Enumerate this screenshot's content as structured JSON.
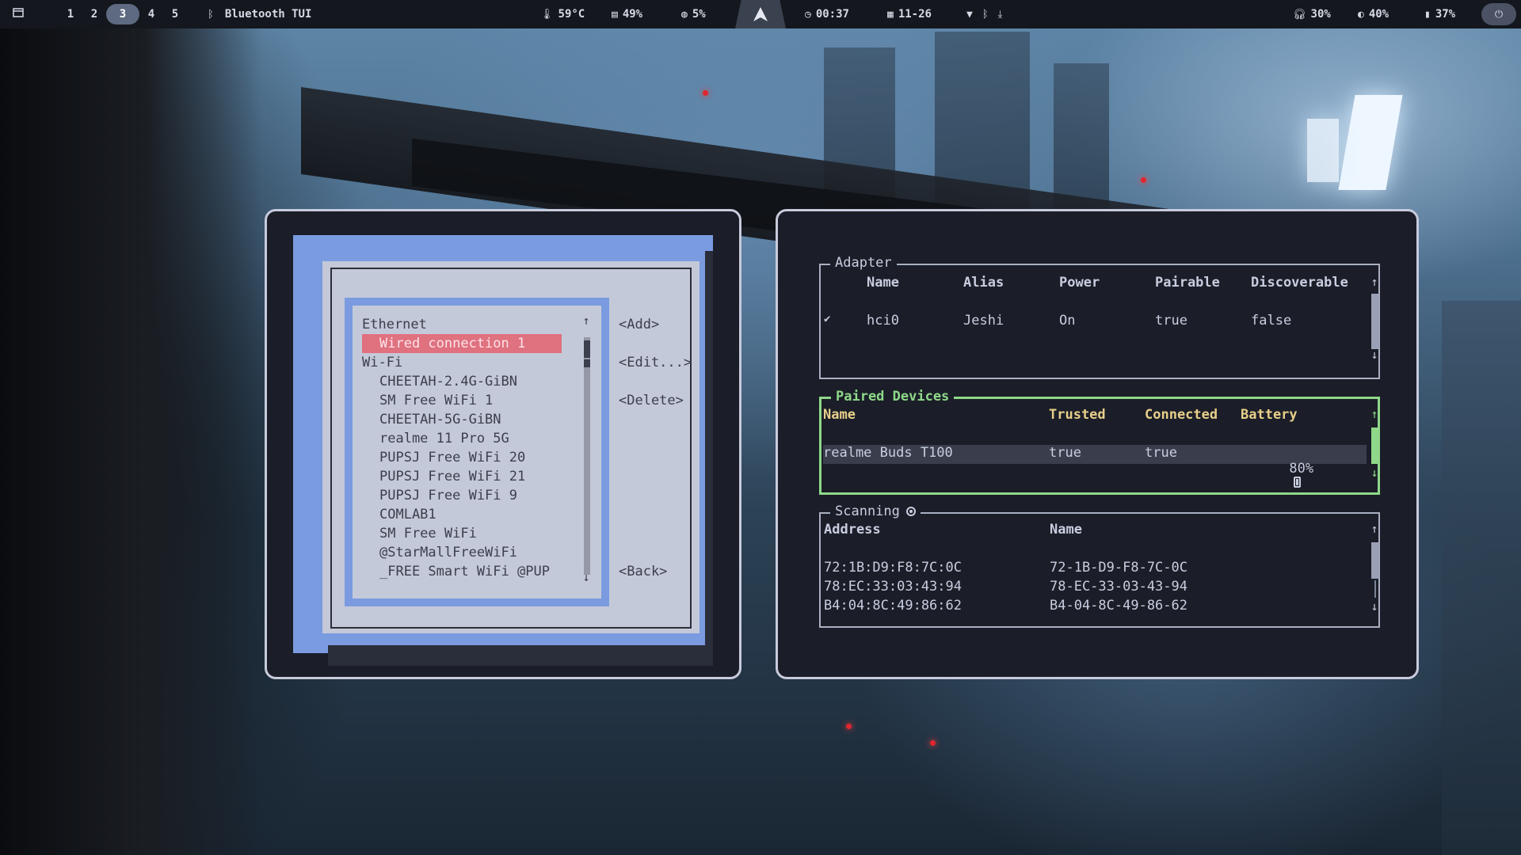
{
  "topbar": {
    "workspaces": [
      "1",
      "2",
      "3",
      "4",
      "5"
    ],
    "active_workspace": "3",
    "active_window": "Bluetooth TUI",
    "temperature": "59°C",
    "memory": "49%",
    "cpu": "5%",
    "clock": "00:37",
    "date": "11-26",
    "headphones": "30%",
    "brightness": "40%",
    "battery": "37%",
    "icons": {
      "layout": "window-layout-icon",
      "bluetooth": "bluetooth-icon",
      "temperature": "thermometer-icon",
      "memory": "memory-icon",
      "cpu": "cpu-icon",
      "clock": "clock-icon",
      "calendar": "calendar-icon",
      "wifi": "wifi-icon",
      "download": "download-icon",
      "headphones": "headphones-icon",
      "brightness": "brightness-icon",
      "battery": "battery-icon",
      "power": "power-icon"
    }
  },
  "nmtui": {
    "ethernet_header": "Ethernet",
    "selected_connection": "Wired connection 1",
    "wifi_header": "Wi-Fi",
    "wifi_networks": [
      "CHEETAH-2.4G-GiBN",
      "SM Free WiFi 1",
      "CHEETAH-5G-GiBN",
      "realme 11 Pro 5G",
      "PUPSJ Free WiFi 20",
      "PUPSJ Free WiFi 21",
      "PUPSJ Free WiFi 9",
      "COMLAB1",
      "SM Free WiFi",
      "@StarMallFreeWiFi",
      "_FREE Smart WiFi @PUP"
    ],
    "buttons": {
      "add": "<Add>",
      "edit": "<Edit...>",
      "delete": "<Delete>",
      "back": "<Back>"
    },
    "scroll_up": "↑",
    "scroll_down": "↓"
  },
  "bluetooth": {
    "adapter": {
      "title": "Adapter",
      "columns": [
        "Name",
        "Alias",
        "Power",
        "Pairable",
        "Discoverable"
      ],
      "rows": [
        {
          "check": "✔",
          "name": "hci0",
          "alias": "Jeshi",
          "power": "On",
          "pairable": "true",
          "discoverable": "false"
        }
      ]
    },
    "paired": {
      "title": "Paired Devices",
      "columns": [
        "Name",
        "Trusted",
        "Connected",
        "Battery"
      ],
      "rows": [
        {
          "name": "realme Buds T100",
          "trusted": "true",
          "connected": "true",
          "battery": "80%"
        }
      ]
    },
    "scanning": {
      "title": "Scanning",
      "columns": [
        "Address",
        "Name"
      ],
      "rows": [
        {
          "address": "72:1B:D9:F8:7C:0C",
          "name": "72-1B-D9-F8-7C-0C"
        },
        {
          "address": "78:EC:33:03:43:94",
          "name": "78-EC-33-03-43-94"
        },
        {
          "address": "B4:04:8C:49:86:62",
          "name": "B4-04-8C-49-86-62"
        }
      ]
    },
    "scroll_up": "↑",
    "scroll_down": "↓"
  }
}
